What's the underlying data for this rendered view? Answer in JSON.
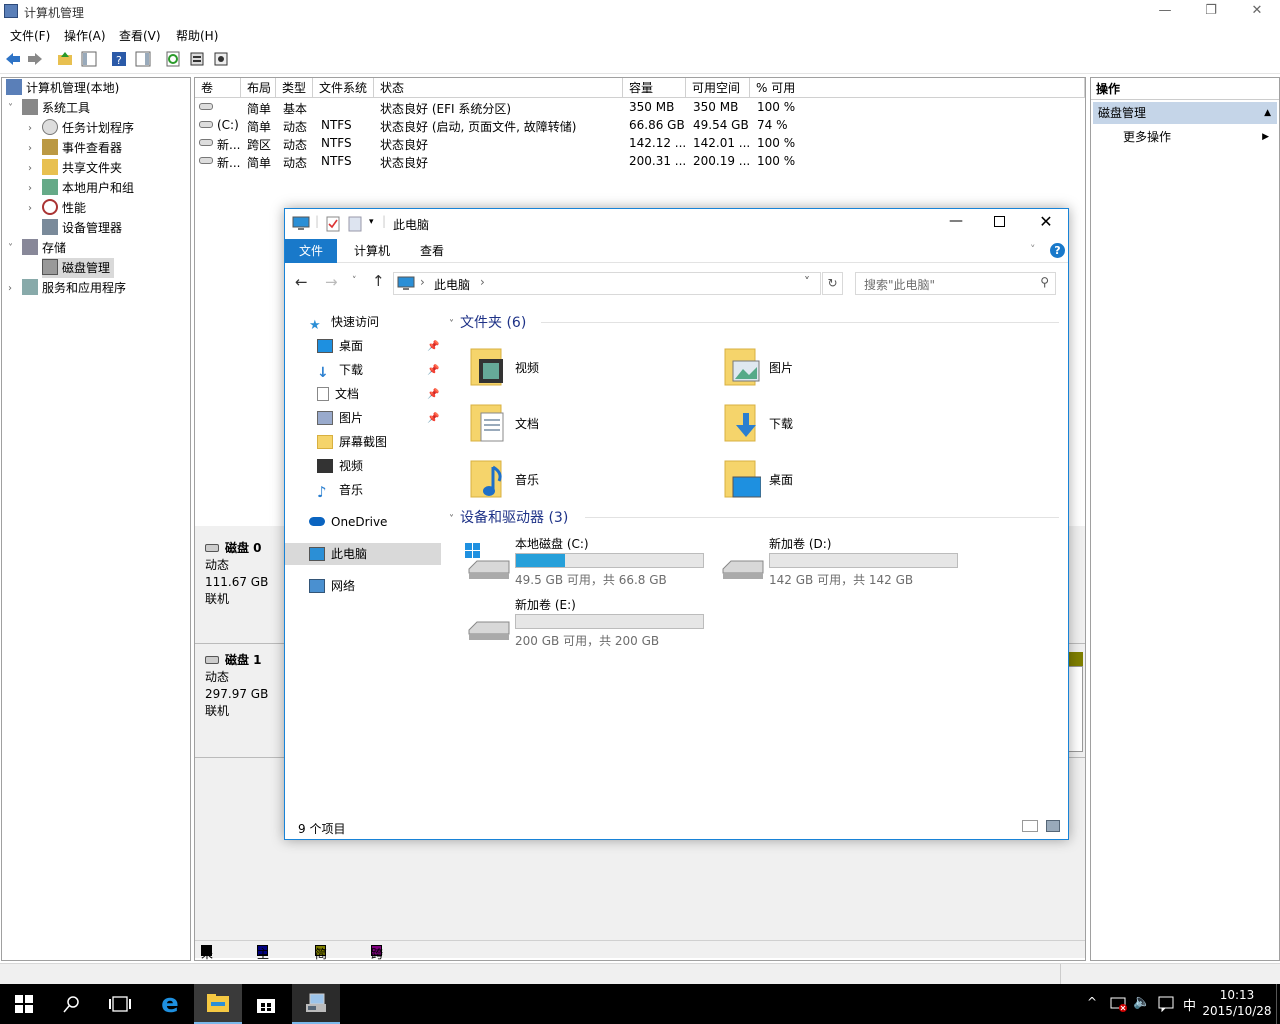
{
  "cm": {
    "title": "计算机管理",
    "menu": [
      "文件(F)",
      "操作(A)",
      "查看(V)",
      "帮助(H)"
    ],
    "tree": {
      "root": "计算机管理(本地)",
      "system_tools": "系统工具",
      "task_scheduler": "任务计划程序",
      "event_viewer": "事件查看器",
      "shared_folders": "共享文件夹",
      "local_users": "本地用户和组",
      "performance": "性能",
      "device_manager": "设备管理器",
      "storage": "存储",
      "disk_management": "磁盘管理",
      "services": "服务和应用程序"
    },
    "volumes": {
      "headers": [
        "卷",
        "布局",
        "类型",
        "文件系统",
        "状态",
        "容量",
        "可用空间",
        "% 可用"
      ],
      "rows": [
        [
          "",
          "简单",
          "基本",
          "",
          "状态良好 (EFI 系统分区)",
          "350 MB",
          "350 MB",
          "100 %"
        ],
        [
          "(C:)",
          "简单",
          "动态",
          "NTFS",
          "状态良好 (启动, 页面文件, 故障转储)",
          "66.86 GB",
          "49.54 GB",
          "74 %"
        ],
        [
          "新...",
          "跨区",
          "动态",
          "NTFS",
          "状态良好",
          "142.12 ...",
          "142.01 ...",
          "100 %"
        ],
        [
          "新...",
          "简单",
          "动态",
          "NTFS",
          "状态良好",
          "200.31 ...",
          "200.19 ...",
          "100 %"
        ]
      ]
    },
    "disks": [
      {
        "name": "磁盘 0",
        "type": "动态",
        "size": "111.67 GB",
        "state": "联机"
      },
      {
        "name": "磁盘 1",
        "type": "动态",
        "size": "297.97 GB",
        "state": "联机"
      }
    ],
    "legend": [
      {
        "label": "未分配",
        "color": "#000000"
      },
      {
        "label": "主分区",
        "color": "#00007f"
      },
      {
        "label": "简单卷",
        "color": "#7f7f00"
      },
      {
        "label": "跨区卷",
        "color": "#7f007f"
      }
    ],
    "actions": {
      "header": "操作",
      "section": "磁盘管理",
      "more": "更多操作"
    }
  },
  "explorer": {
    "title": "此电脑",
    "tabs": [
      "文件",
      "计算机",
      "查看"
    ],
    "address": "此电脑",
    "search_placeholder": "搜索\"此电脑\"",
    "nav": {
      "quick_access": "快速访问",
      "desktop": "桌面",
      "downloads": "下载",
      "documents": "文档",
      "pictures": "图片",
      "screenshots": "屏幕截图",
      "videos": "视频",
      "music": "音乐",
      "onedrive": "OneDrive",
      "this_pc": "此电脑",
      "network": "网络"
    },
    "folders_group": "文件夹 (6)",
    "folders": [
      "视频",
      "图片",
      "文档",
      "下载",
      "音乐",
      "桌面"
    ],
    "drives_group": "设备和驱动器 (3)",
    "drives": [
      {
        "name": "本地磁盘 (C:)",
        "status": "49.5 GB 可用，共 66.8 GB",
        "used_fraction": 0.26
      },
      {
        "name": "新加卷 (D:)",
        "status": "142 GB 可用，共 142 GB",
        "used_fraction": 0.0
      },
      {
        "name": "新加卷 (E:)",
        "status": "200 GB 可用，共 200 GB",
        "used_fraction": 0.0
      }
    ],
    "status": "9 个项目"
  },
  "taskbar": {
    "time": "10:13",
    "date": "2015/10/28",
    "ime": "中"
  }
}
